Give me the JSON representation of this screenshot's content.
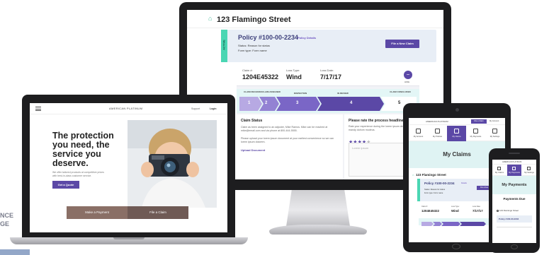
{
  "colors": {
    "accent_purple": "#5b48a6",
    "active_green": "#4ad6b3",
    "policy_card_bg": "#e8eef6",
    "progress_bg": "#e3f6f6",
    "hero_button": "#5b48a6",
    "payment_button": "#8a6f66",
    "claim_button": "#6f5a55"
  },
  "left_edge": {
    "line1": "NCE",
    "line2": "GE"
  },
  "monitor": {
    "address": "123 Flamingo Street",
    "home_icon": "home-icon",
    "policy": {
      "active_label": "ACTIVE",
      "title": "Policy #100-00-2234",
      "details_link": "Policy Details",
      "status": "Status: Reason for status",
      "form_type": "Form type: Form name",
      "file_button": "File a New Claim"
    },
    "claim": {
      "number_label": "Claim #:",
      "number": "1204E45322",
      "loss_type_label": "Loss Type:",
      "loss_type": "Wind",
      "loss_date_label": "Loss Date:",
      "loss_date": "7/17/17",
      "toggle_symbol": "−",
      "toggle_label": "HIDE"
    },
    "progress": {
      "stages": [
        "CLAIM RECEIVED",
        "CLAIM ASSIGNED",
        "INSPECTION",
        "IN REVIEW",
        "CLAIM CONCLUDED"
      ],
      "steps": [
        "1",
        "2",
        "3",
        "4",
        "5"
      ],
      "current_step": 4
    },
    "claim_status": {
      "heading": "Claim Status",
      "body": "Claim as been assigned to an adjuster, Mike Ramos. Mike can be reached at mike@email.com and via phone at 800-444-5555.",
      "upload_hint": "Please upload your lorem ipsum document at your earliest convenience so we can lorem ipsum dolorem.",
      "upload_link": "Upload Document"
    },
    "rating": {
      "heading": "Please rate the process headline",
      "body": "Rate your experience during the lorem ipsum delivered mandy dolrum modeus.",
      "stars_filled": 4,
      "stars_total": 5,
      "textarea_placeholder": "Lorem ipsum"
    }
  },
  "laptop": {
    "brand": "AMERICAN PLATINUM",
    "nav_link": "Support",
    "login": "Login",
    "hero_title": "The protection you need, the service you deserve.",
    "hero_sub": "We offer tailored products at competitive prices with best-in-class customer service.",
    "quote_button": "Get a Quote",
    "payment_button": "Make a Payment",
    "claim_button": "File a Claim"
  },
  "tablet": {
    "brand": "AMERICAN PLATINUM",
    "file_button": "File a Claim",
    "account": "My Account",
    "nav": [
      "My Account",
      "My Policies",
      "My Claims",
      "My Payments",
      "My Settings"
    ],
    "active_nav": 2,
    "page_title": "My Claims",
    "address": "123 Flamingo Street",
    "policy": {
      "title": "Policy #100-00-2234",
      "details_link": "Details",
      "file_button": "File a New Claim",
      "status": "Status: Reason for status",
      "form_type": "Form type: Form name"
    },
    "claim": {
      "number_label": "Claim #:",
      "number": "1204E45322",
      "loss_type_label": "Loss Type:",
      "loss_type": "Wind",
      "loss_date_label": "Loss Date:",
      "loss_date": "7/17/17"
    }
  },
  "phone": {
    "brand": "AMERICAN PLATINUM",
    "nav": [
      "My Claims",
      "My Payments",
      "My Settings"
    ],
    "active_nav": 1,
    "page_title": "My Payments",
    "due_heading": "Payments Due",
    "address": "123 Flamingo Street",
    "policy": "Policy #100-00-2234"
  }
}
